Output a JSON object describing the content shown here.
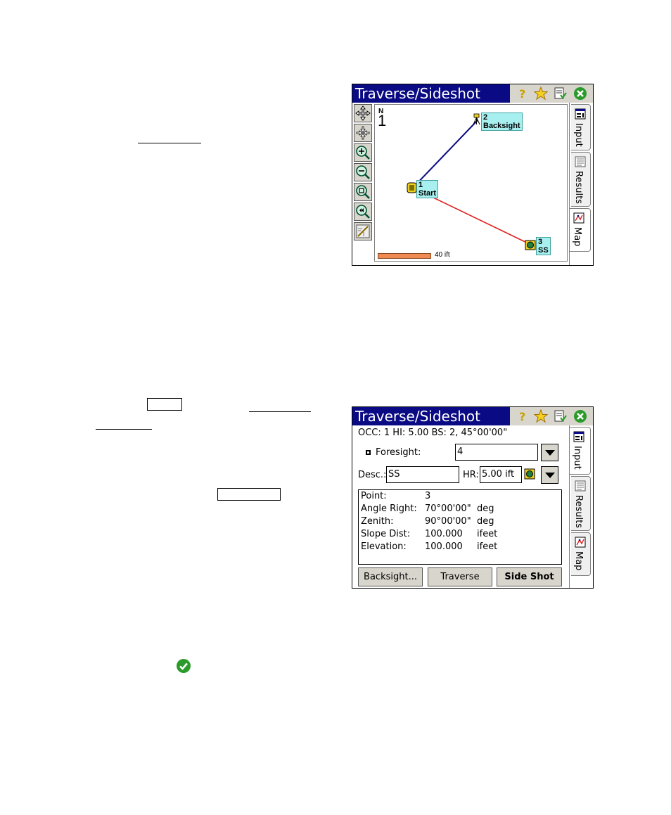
{
  "window_title": "Traverse/Sideshot",
  "tabs": [
    {
      "label": "Input"
    },
    {
      "label": "Results"
    },
    {
      "label": "Map"
    }
  ],
  "map": {
    "north_label": "N",
    "north_value": "1",
    "points": [
      {
        "number": "1",
        "name": "Start"
      },
      {
        "number": "2",
        "name": "Backsight"
      },
      {
        "number": "3",
        "name": "SS"
      }
    ],
    "scale_label": "40 ift",
    "colors": {
      "backsight_line": "#0a0a84",
      "sideshot_line": "#e02020",
      "label_bg": "#a8f0f0",
      "scale_bar": "#ef8a52"
    }
  },
  "input": {
    "header": "OCC: 1  HI: 5.00  BS: 2, 45°00'00\"",
    "foresight_label": "Foresight:",
    "foresight_value": "4",
    "desc_label": "Desc.:",
    "desc_value": "SS",
    "hr_label": "HR:",
    "hr_value": "5.00 ift",
    "results": [
      {
        "label": "Point:",
        "value": "3",
        "unit": ""
      },
      {
        "label": "Angle Right:",
        "value": "70°00'00\"",
        "unit": "deg"
      },
      {
        "label": "Zenith:",
        "value": "90°00'00\"",
        "unit": "deg"
      },
      {
        "label": "Slope Dist:",
        "value": "100.000",
        "unit": "ifeet"
      },
      {
        "label": "Elevation:",
        "value": "100.000",
        "unit": "ifeet"
      }
    ],
    "buttons": {
      "backsight": "Backsight...",
      "traverse": "Traverse",
      "side_shot": "Side Shot"
    }
  },
  "colors": {
    "titlebar": "#0a0a84",
    "ok_green": "#2a9a2a",
    "close_green": "#2a9a2a"
  }
}
